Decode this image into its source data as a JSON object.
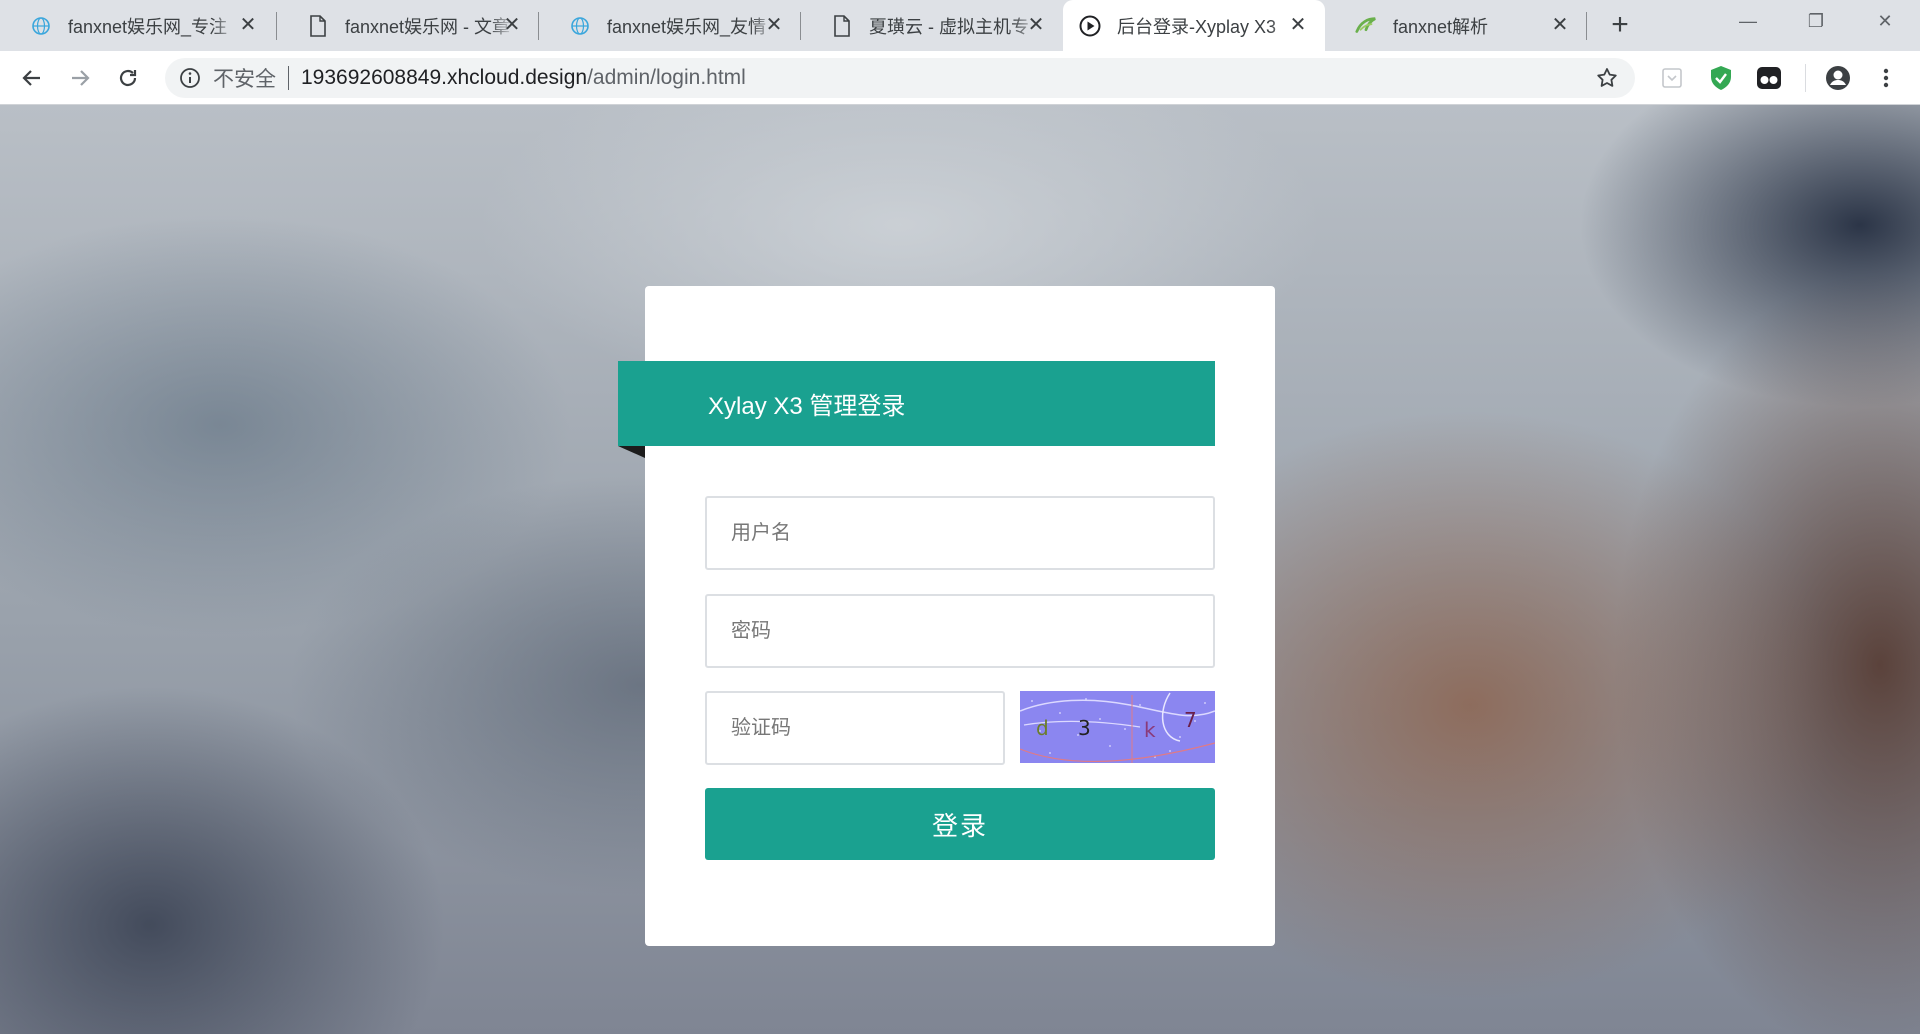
{
  "browser": {
    "tabs": [
      {
        "title": "fanxnet娱乐网_专注",
        "icon": "globe-tab-icon"
      },
      {
        "title": "fanxnet娱乐网 - 文章",
        "icon": "page-tab-icon"
      },
      {
        "title": "fanxnet娱乐网_友情",
        "icon": "globe-tab-icon"
      },
      {
        "title": "夏璜云 - 虚拟主机专",
        "icon": "page-tab-icon"
      },
      {
        "title": "后台登录-Xyplay X3",
        "icon": "play-tab-icon",
        "active": true
      },
      {
        "title": "fanxnet解析",
        "icon": "leaf-tab-icon"
      }
    ],
    "close_glyph": "✕",
    "new_tab_glyph": "+",
    "window_controls": {
      "minimize": "—",
      "restore": "❐",
      "close": "✕"
    },
    "address": {
      "security_label": "不安全",
      "host": "193692608849.xhcloud.design",
      "path": "/admin/login.html"
    }
  },
  "login": {
    "title": "Xylay X3 管理登录",
    "username_placeholder": "用户名",
    "password_placeholder": "密码",
    "captcha_placeholder": "验证码",
    "captcha_text": [
      "d",
      "3",
      "k",
      "7"
    ],
    "submit_label": "登录"
  },
  "colors": {
    "accent": "#1aa190",
    "captcha_bg": "#8b86f0",
    "shield": "#34a853"
  }
}
